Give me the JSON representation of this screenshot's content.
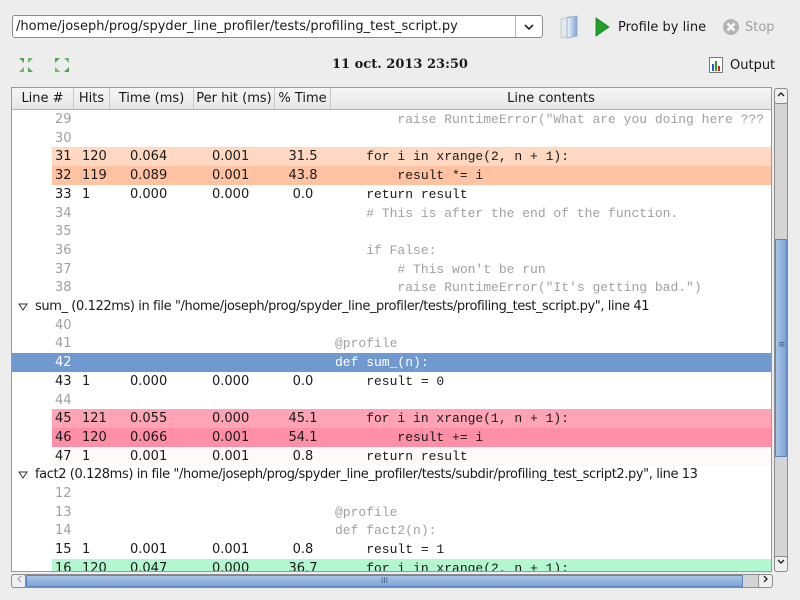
{
  "toolbar": {
    "file_path": "/home/joseph/prog/spyder_line_profiler/tests/profiling_test_script.py",
    "profile_label": "Profile by line",
    "stop_label": "Stop",
    "datetime": "11 oct. 2013 23:50",
    "output_label": "Output"
  },
  "icons": {
    "dropdown": "chevron-down-icon",
    "browse": "folder-icon",
    "profile": "play-icon",
    "stop": "stop-icon",
    "collapse": "collapse-all-icon",
    "expand": "expand-all-icon",
    "output": "bar-chart-icon"
  },
  "colors": {
    "orange_light": "#ffd8c2",
    "orange": "#ffc3a3",
    "pink_light": "#ffa3b7",
    "pink": "#ff8fa6",
    "green": "#b3f7d1",
    "selection": "#7099d0",
    "faint": "#fffafa"
  },
  "table": {
    "columns": [
      "Line #",
      "Hits",
      "Time (ms)",
      "Per hit (ms)",
      "% Time",
      "Line contents"
    ],
    "rows": [
      {
        "type": "line",
        "line": "29",
        "hits": "",
        "time": "",
        "perhit": "",
        "pct": "",
        "code": "        raise RuntimeError(\"What are you doing here ???",
        "style": "gray"
      },
      {
        "type": "line",
        "line": "30",
        "hits": "",
        "time": "",
        "perhit": "",
        "pct": "",
        "code": "",
        "style": "gray"
      },
      {
        "type": "line",
        "line": "31",
        "hits": "120",
        "time": "0.064",
        "perhit": "0.001",
        "pct": "31.5",
        "code": "    for i in xrange(2, n + 1):",
        "style": "orange_light"
      },
      {
        "type": "line",
        "line": "32",
        "hits": "119",
        "time": "0.089",
        "perhit": "0.001",
        "pct": "43.8",
        "code": "        result *= i",
        "style": "orange"
      },
      {
        "type": "line",
        "line": "33",
        "hits": "1",
        "time": "0.000",
        "perhit": "0.000",
        "pct": "0.0",
        "code": "    return result",
        "style": "normal"
      },
      {
        "type": "line",
        "line": "34",
        "hits": "",
        "time": "",
        "perhit": "",
        "pct": "",
        "code": "    # This is after the end of the function.",
        "style": "gray"
      },
      {
        "type": "line",
        "line": "35",
        "hits": "",
        "time": "",
        "perhit": "",
        "pct": "",
        "code": "",
        "style": "gray"
      },
      {
        "type": "line",
        "line": "36",
        "hits": "",
        "time": "",
        "perhit": "",
        "pct": "",
        "code": "    if False:",
        "style": "gray"
      },
      {
        "type": "line",
        "line": "37",
        "hits": "",
        "time": "",
        "perhit": "",
        "pct": "",
        "code": "        # This won't be run",
        "style": "gray"
      },
      {
        "type": "line",
        "line": "38",
        "hits": "",
        "time": "",
        "perhit": "",
        "pct": "",
        "code": "        raise RuntimeError(\"It's getting bad.\")",
        "style": "gray"
      },
      {
        "type": "group",
        "text": "sum_ (0.122ms) in file \"/home/joseph/prog/spyder_line_profiler/tests/profiling_test_script.py\", line 41"
      },
      {
        "type": "line",
        "line": "40",
        "hits": "",
        "time": "",
        "perhit": "",
        "pct": "",
        "code": "",
        "style": "gray"
      },
      {
        "type": "line",
        "line": "41",
        "hits": "",
        "time": "",
        "perhit": "",
        "pct": "",
        "code": "@profile",
        "style": "gray"
      },
      {
        "type": "line",
        "line": "42",
        "hits": "",
        "time": "",
        "perhit": "",
        "pct": "",
        "code": "def sum_(n):",
        "style": "selected"
      },
      {
        "type": "line",
        "line": "43",
        "hits": "1",
        "time": "0.000",
        "perhit": "0.000",
        "pct": "0.0",
        "code": "    result = 0",
        "style": "normal"
      },
      {
        "type": "line",
        "line": "44",
        "hits": "",
        "time": "",
        "perhit": "",
        "pct": "",
        "code": "",
        "style": "gray"
      },
      {
        "type": "line",
        "line": "45",
        "hits": "121",
        "time": "0.055",
        "perhit": "0.000",
        "pct": "45.1",
        "code": "    for i in xrange(1, n + 1):",
        "style": "pink_light"
      },
      {
        "type": "line",
        "line": "46",
        "hits": "120",
        "time": "0.066",
        "perhit": "0.001",
        "pct": "54.1",
        "code": "        result += i",
        "style": "pink"
      },
      {
        "type": "line",
        "line": "47",
        "hits": "1",
        "time": "0.001",
        "perhit": "0.001",
        "pct": "0.8",
        "code": "    return result",
        "style": "faint"
      },
      {
        "type": "group",
        "text": "fact2 (0.128ms) in file \"/home/joseph/prog/spyder_line_profiler/tests/subdir/profiling_test_script2.py\", line 13"
      },
      {
        "type": "line",
        "line": "12",
        "hits": "",
        "time": "",
        "perhit": "",
        "pct": "",
        "code": "",
        "style": "gray"
      },
      {
        "type": "line",
        "line": "13",
        "hits": "",
        "time": "",
        "perhit": "",
        "pct": "",
        "code": "@profile",
        "style": "gray"
      },
      {
        "type": "line",
        "line": "14",
        "hits": "",
        "time": "",
        "perhit": "",
        "pct": "",
        "code": "def fact2(n):",
        "style": "gray"
      },
      {
        "type": "line",
        "line": "15",
        "hits": "1",
        "time": "0.001",
        "perhit": "0.001",
        "pct": "0.8",
        "code": "    result = 1",
        "style": "normal"
      },
      {
        "type": "line",
        "line": "16",
        "hits": "120",
        "time": "0.047",
        "perhit": "0.000",
        "pct": "36.7",
        "code": "    for i in xrange(2, n + 1):",
        "style": "green"
      }
    ]
  },
  "scrollbars": {
    "vertical_grip": "≡",
    "horizontal_grip": "III"
  }
}
